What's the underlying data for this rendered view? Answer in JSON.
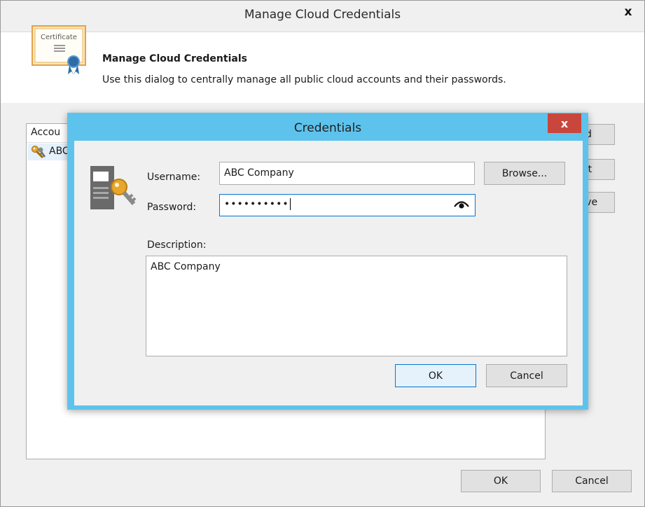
{
  "outer": {
    "title": "Manage Cloud Credentials",
    "close_glyph": "x",
    "header": {
      "title": "Manage Cloud Credentials",
      "description": "Use this dialog to centrally manage all public cloud accounts and their passwords.",
      "icon_label": "Certificate"
    },
    "list": {
      "column_header": "Accou",
      "rows": [
        {
          "text": "ABC"
        }
      ]
    },
    "side_buttons": {
      "add": "dd",
      "edit": "dit",
      "remove": "nove"
    },
    "ok": "OK",
    "cancel": "Cancel"
  },
  "credentials": {
    "title": "Credentials",
    "close_glyph": "x",
    "username_label": "Username:",
    "username_value": "ABC Company",
    "browse": "Browse...",
    "password_label": "Password:",
    "password_masked": "••••••••••",
    "description_label": "Description:",
    "description_value": "ABC Company",
    "ok": "OK",
    "cancel": "Cancel"
  },
  "colors": {
    "inner_frame": "#5ec3ec",
    "inner_close": "#c9463d",
    "focus_border": "#0078d7",
    "dialog_bg": "#f0f0f0"
  },
  "icons": [
    "certificate-icon",
    "key-icon",
    "credentials-icon",
    "eye-icon"
  ]
}
